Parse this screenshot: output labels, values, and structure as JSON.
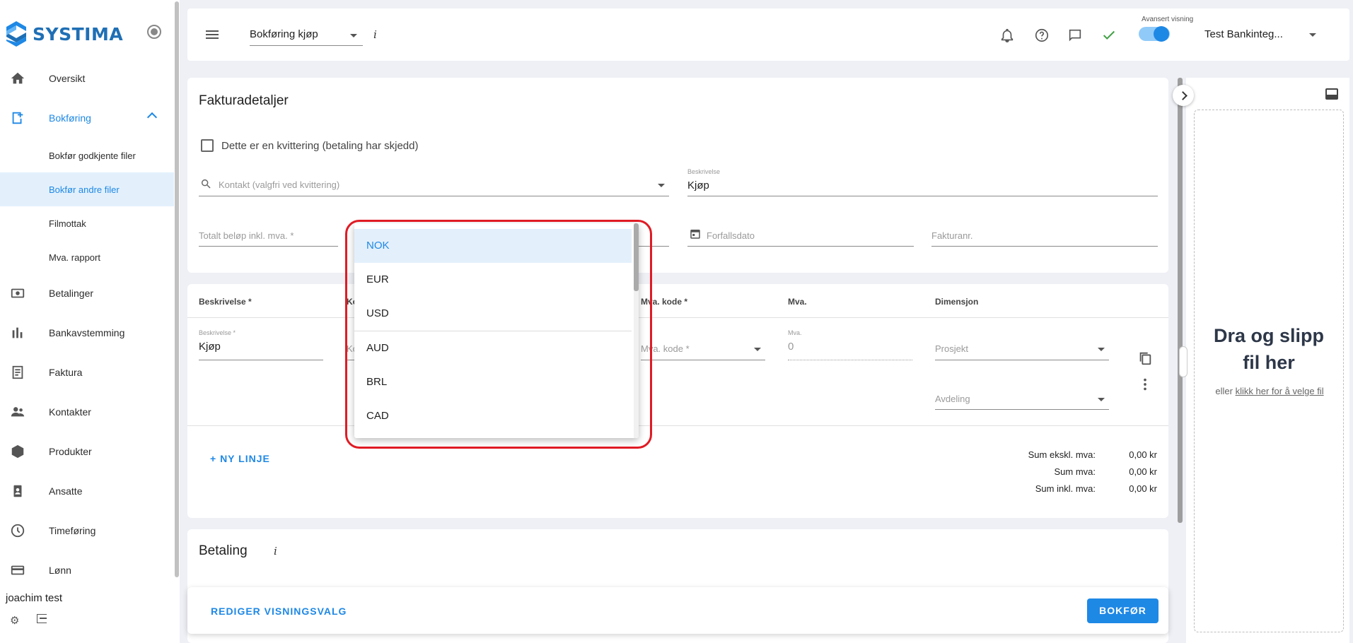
{
  "app": {
    "brand": "SYSTIMA"
  },
  "sidebar": {
    "items": [
      {
        "label": "Oversikt",
        "icon": "home-icon"
      },
      {
        "label": "Bokføring",
        "icon": "bookkeeping-icon"
      },
      {
        "label": "Betalinger",
        "icon": "payments-icon"
      },
      {
        "label": "Bankavstemming",
        "icon": "bank-reconcile-icon"
      },
      {
        "label": "Faktura",
        "icon": "invoice-icon"
      },
      {
        "label": "Kontakter",
        "icon": "contacts-icon"
      },
      {
        "label": "Produkter",
        "icon": "products-icon"
      },
      {
        "label": "Ansatte",
        "icon": "employees-icon"
      },
      {
        "label": "Timeføring",
        "icon": "clock-icon"
      },
      {
        "label": "Lønn",
        "icon": "payroll-icon"
      }
    ],
    "subitems": [
      {
        "label": "Bokfør godkjente filer"
      },
      {
        "label": "Bokfør andre filer"
      },
      {
        "label": "Filmottak"
      },
      {
        "label": "Mva. rapport"
      }
    ],
    "user": {
      "name": "joachim test"
    }
  },
  "topbar": {
    "mode": "Bokføring kjøp",
    "info": "i",
    "advanced_label": "Avansert visning",
    "company": "Test Bankinteg..."
  },
  "invoice": {
    "title": "Fakturadetaljer",
    "receipt_checkbox": "Dette er en kvittering (betaling har skjedd)",
    "contact_placeholder": "Kontakt (valgfri ved kvittering)",
    "description_label": "Beskrivelse",
    "description_value": "Kjøp",
    "total_placeholder": "Totalt beløp inkl. mva. *",
    "due_date_placeholder": "Forfallsdato",
    "invoice_no_placeholder": "Fakturanr."
  },
  "lines": {
    "headers": {
      "description": "Beskrivelse *",
      "account": "Ko",
      "vat_code": "Mva. kode *",
      "vat": "Mva.",
      "dimension": "Dimensjon"
    },
    "row": {
      "description_label": "Beskrivelse *",
      "description_value": "Kjøp",
      "account_placeholder": "Ko",
      "vat_code_placeholder": "Mva. kode *",
      "vat_label": "Mva.",
      "vat_value": "0",
      "project_placeholder": "Prosjekt",
      "department_placeholder": "Avdeling"
    },
    "new_line": "+ NY LINJE",
    "sums": [
      {
        "label": "Sum ekskl. mva:",
        "value": "0,00 kr"
      },
      {
        "label": "Sum mva:",
        "value": "0,00 kr"
      },
      {
        "label": "Sum inkl. mva:",
        "value": "0,00 kr"
      }
    ]
  },
  "payment": {
    "title": "Betaling",
    "info": "i"
  },
  "bottom": {
    "edit_view": "REDIGER VISNINGSVALG",
    "submit": "BOKFØR"
  },
  "upload": {
    "title_line1": "Dra og slipp",
    "title_line2": "fil her",
    "sub_prefix": "eller ",
    "sub_link": "klikk her for å velge fil"
  },
  "currency_dropdown": {
    "selected": "NOK",
    "options": [
      "NOK",
      "EUR",
      "USD",
      "AUD",
      "BRL",
      "CAD"
    ]
  },
  "colors": {
    "accent": "#1e88e5",
    "highlight": "#e01b24"
  }
}
